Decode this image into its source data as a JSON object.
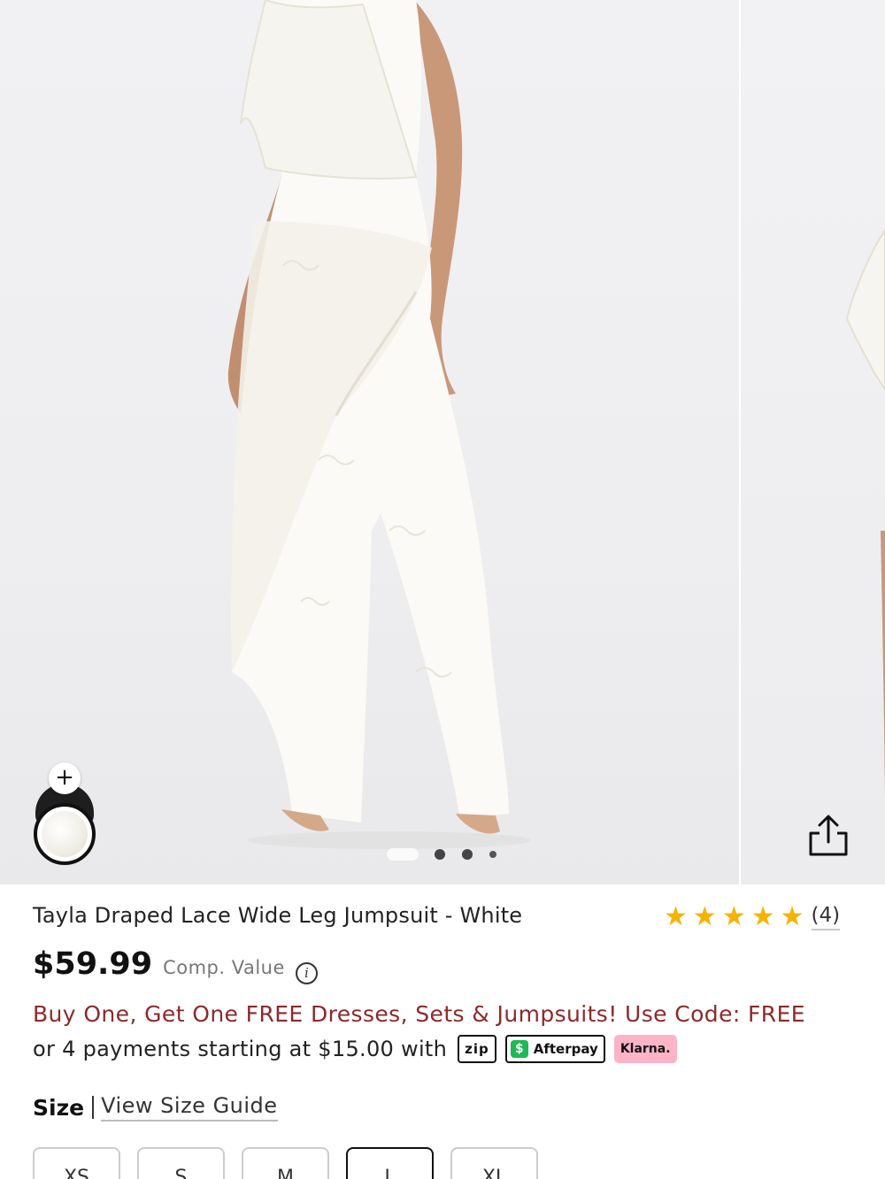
{
  "gallery": {
    "dots": {
      "total": 4,
      "active_index": 0
    },
    "swatches": [
      {
        "name": "black-swatch-icon"
      },
      {
        "name": "white-lace-swatch-icon",
        "selected": true
      }
    ],
    "add_swatch_symbol": "+",
    "share_icon": "share-icon"
  },
  "product": {
    "title": "Tayla Draped Lace Wide Leg Jumpsuit - White",
    "rating": {
      "stars": 5,
      "star_glyph": "★",
      "count_label": "(4)"
    },
    "price": "$59.99",
    "comp_value_label": "Comp. Value",
    "info_symbol": "i",
    "promo": "Buy One, Get One FREE Dresses, Sets & Jumpsuits! Use Code: FREE",
    "installments_text": "or 4 payments starting at $15.00 with",
    "payment_badges": {
      "zip": "zip",
      "afterpay_mark": "$",
      "afterpay": "Afterpay",
      "klarna": "Klarna."
    },
    "size_label": "Size",
    "size_guide_label": "View Size Guide",
    "sizes": [
      {
        "label": "XS",
        "selected": false
      },
      {
        "label": "S",
        "selected": false
      },
      {
        "label": "M",
        "selected": false
      },
      {
        "label": "L",
        "selected": true
      },
      {
        "label": "XL",
        "selected": false
      }
    ]
  },
  "colors": {
    "promo": "#8b2a2a",
    "star": "#f5b301",
    "afterpay_green": "#1db954",
    "klarna_pink": "#ffb3c7"
  }
}
